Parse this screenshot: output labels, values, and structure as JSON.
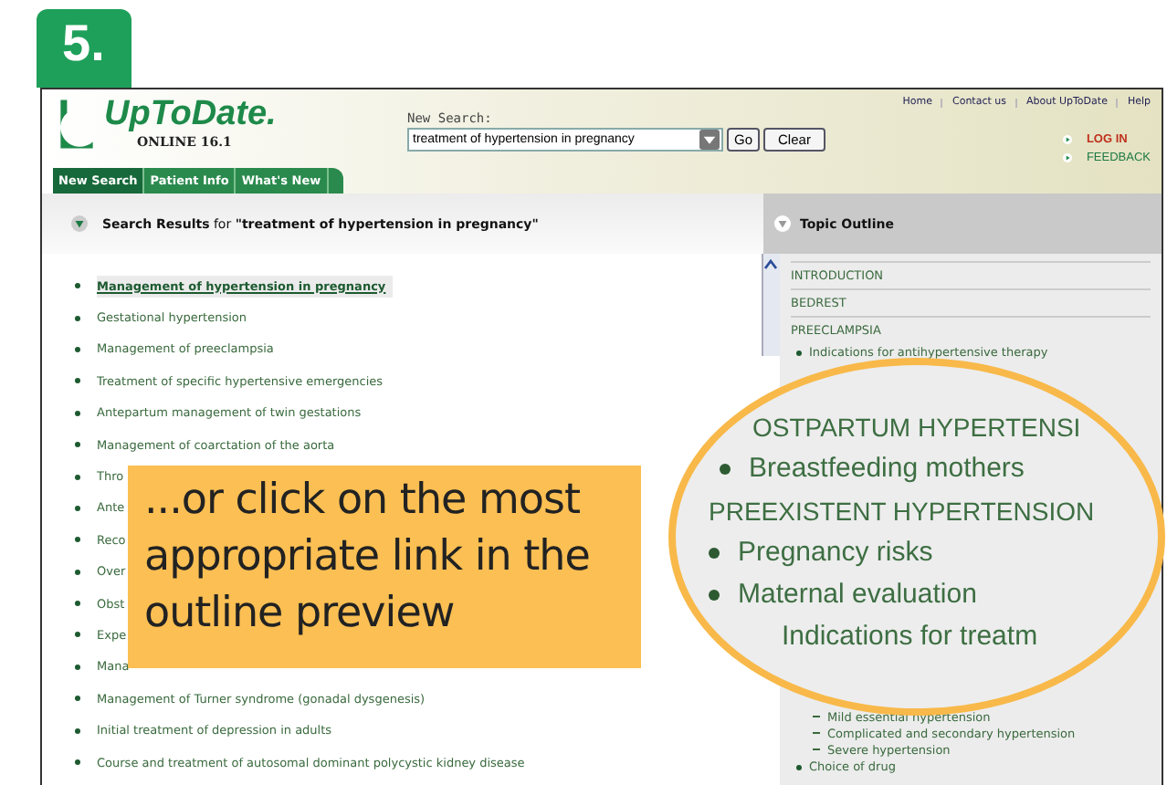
{
  "step": "5.",
  "header": {
    "logo": "UpToDate.",
    "edition": "ONLINE 16.1",
    "search_label": "New Search:",
    "search_value": "treatment of hypertension in pregnancy",
    "go": "Go",
    "clear": "Clear",
    "links": [
      "Home",
      "Contact us",
      "About UpToDate",
      "Help"
    ],
    "actions": [
      {
        "label": "LOG IN",
        "kind": "login"
      },
      {
        "label": "FEEDBACK",
        "kind": "plain"
      }
    ],
    "tabs": [
      {
        "label": "New Search",
        "selected": true
      },
      {
        "label": "Patient Info",
        "selected": false
      },
      {
        "label": "What's New",
        "selected": false
      }
    ]
  },
  "results": {
    "heading": "Search Results",
    "for": "for",
    "query": "\"treatment of hypertension in pregnancy\"",
    "items": [
      {
        "label": "Management of hypertension in pregnancy",
        "selected": true
      },
      {
        "label": "Gestational hypertension",
        "selected": false
      },
      {
        "label": "Management of preeclampsia",
        "selected": false
      },
      {
        "label": "Treatment of specific hypertensive emergencies",
        "selected": false
      },
      {
        "label": "Antepartum management of twin gestations",
        "selected": false
      },
      {
        "label": "Management of coarctation of the aorta",
        "selected": false
      },
      {
        "label": "Thro",
        "selected": false
      },
      {
        "label": "Ante",
        "selected": false
      },
      {
        "label": "Reco",
        "selected": false
      },
      {
        "label": "Over",
        "selected": false
      },
      {
        "label": "Obst",
        "selected": false
      },
      {
        "label": "Expe",
        "selected": false
      },
      {
        "label": "Mana",
        "selected": false
      },
      {
        "label": "Management of Turner syndrome (gonadal dysgenesis)",
        "selected": false
      },
      {
        "label": "Initial treatment of depression in adults",
        "selected": false
      },
      {
        "label": "Course and treatment of autosomal dominant polycystic kidney disease",
        "selected": false
      }
    ]
  },
  "outline": {
    "title": "Topic Outline",
    "items": [
      {
        "label": "INTRODUCTION",
        "kind": "section"
      },
      {
        "label": "BEDREST",
        "kind": "section"
      },
      {
        "label": "PREECLAMPSIA",
        "kind": "section"
      },
      {
        "label": "Indications for antihypertensive therapy",
        "kind": "bullet"
      }
    ],
    "lower_items": [
      {
        "label": "Mild essential hypertension",
        "kind": "sub"
      },
      {
        "label": "Complicated and secondary hypertension",
        "kind": "sub"
      },
      {
        "label": "Severe hypertension",
        "kind": "sub"
      },
      {
        "label": "Choice of drug",
        "kind": "bullet"
      }
    ]
  },
  "magnifier": {
    "items": [
      {
        "label": "OSTPARTUM HYPERTENSI",
        "kind": "section"
      },
      {
        "label": "Breastfeeding mothers",
        "kind": "bullet"
      },
      {
        "label": "PREEXISTENT HYPERTENSION",
        "kind": "section"
      },
      {
        "label": "Pregnancy risks",
        "kind": "bullet"
      },
      {
        "label": "Maternal evaluation",
        "kind": "bullet"
      },
      {
        "label": "Indications for treatm",
        "kind": "plain"
      }
    ]
  },
  "callout": "...or click on the most appropriate link in the outline preview"
}
